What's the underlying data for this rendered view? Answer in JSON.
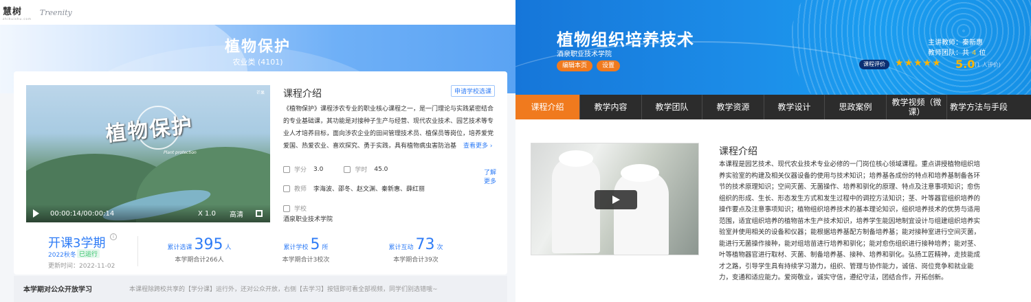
{
  "left": {
    "logo_text": "慧树",
    "logo_domain": "zhihuishu.com",
    "brand2": "Treenity",
    "course_title": "植物保护",
    "course_code": "农业类 (4101)",
    "video": {
      "calligraphy": "植物保护",
      "calligraphy_sub": "Plant protection",
      "watermark": "芒果",
      "time": "00:00:14/00:00:14",
      "speed": "X 1.0",
      "quality": "高清"
    },
    "intro_heading": "课程介绍",
    "apply_button": "申请学校选课",
    "intro_text": "《植物保护》课程涉农专业的职业核心课程之一，是一门理论与实践紧密结合的专业基础课，其功能是对接种子生产与经营、现代农业技术、园艺技术等专业人才培养目标，面向涉农企业的田间管理技术员、植保员等岗位，培养爱党爱国、热爱农业、喜欢探究、勇于实践，具有植物病虫害防治基",
    "more_link": "查看更多 ›",
    "credit_label": "学分",
    "credit_value": "3.0",
    "hours_label": "学时",
    "hours_value": "45.0",
    "teachers_label": "教师",
    "teachers_value": "李海波、邵冬、赵文渊、秦新惠、薛红丽",
    "school_label": "学校",
    "school_value": "酒泉职业技术学院",
    "semester_big": "开课3学期",
    "semester_info_icon": "i",
    "semester_term": "2022秋冬",
    "semester_status": "已运行",
    "semester_update": "更新时间：2022-11-02",
    "stats": [
      {
        "label": "累计选课",
        "value": "395",
        "unit": "人",
        "sub": "本学期合计266人"
      },
      {
        "label": "累计学校",
        "value": "5",
        "unit": "所",
        "sub": "本学期合计3校次"
      },
      {
        "label": "累计互动",
        "value": "73",
        "unit": "次",
        "sub": "本学期合计39次"
      }
    ],
    "more_side": "了解更多",
    "public_title": "本学期对公众开放学习",
    "public_desc": "本课程除跨校共享的【学分课】运行外，还对公众开放，右侧【去学习】按钮即可看全部视频，同学们别选错哦~"
  },
  "right": {
    "title": "植物组织培养技术",
    "school": "酒泉职业技术学院",
    "edit_button": "编辑本页",
    "settings_button": "设置",
    "teacher_line": "主讲教师：秦新惠",
    "team_prefix": "教师团队：共",
    "team_count": "4",
    "team_suffix": "位",
    "eval_button": "课程评价",
    "stars": "★★★★★",
    "score": "5.0",
    "rating_count": "(1 人评价)",
    "tabs": [
      "课程介绍",
      "教学内容",
      "教学团队",
      "教学资源",
      "教学设计",
      "思政案例",
      "教学视频（微课）",
      "教学方法与手段"
    ],
    "active_tab_color": "#f07a1e",
    "intro_heading": "课程介绍",
    "intro_text": "本课程是园艺技术、现代农业技术专业必修的一门岗位核心领域课程。重点讲授植物组织培养实验室的构建及相关仪器设备的使用与技术知识；培养基各成份的特点和培养基制备各环节的技术原理知识；空间灭菌、无菌操作、培养和驯化的原理、特点及注意事项知识；愈伤组织的形成、生长、形态发生方式和发生过程中的调控方法知识；茎、叶等器官组织培养的操作要点及注意事项知识；植物组织培养技术的基本理论知识，组织培养技术的优势与适用范围，适宜组织培养的植物苗木生产技术知识，培养学生能因地制宜设计与组建组织培养实验室并使用相关的设备和仪器；能根据培养基配方制备培养基；能对接种室进行空间灭菌，能进行无菌操作接种，能对组培苗进行培养和驯化；能对愈伤组织进行接种培养；能对茎、叶等植物器官进行取材、灭菌、制备培养基、接种、培养和驯化。弘扬工匠精神，走技能成才之路，引导学生具有持续学习潜力，组织、管理与协作能力，诚信、岗位竞争和就业能力，变通和适应能力。爱岗敬业，诚实守信，遵纪守法，团结合作，开拓创新。"
  }
}
